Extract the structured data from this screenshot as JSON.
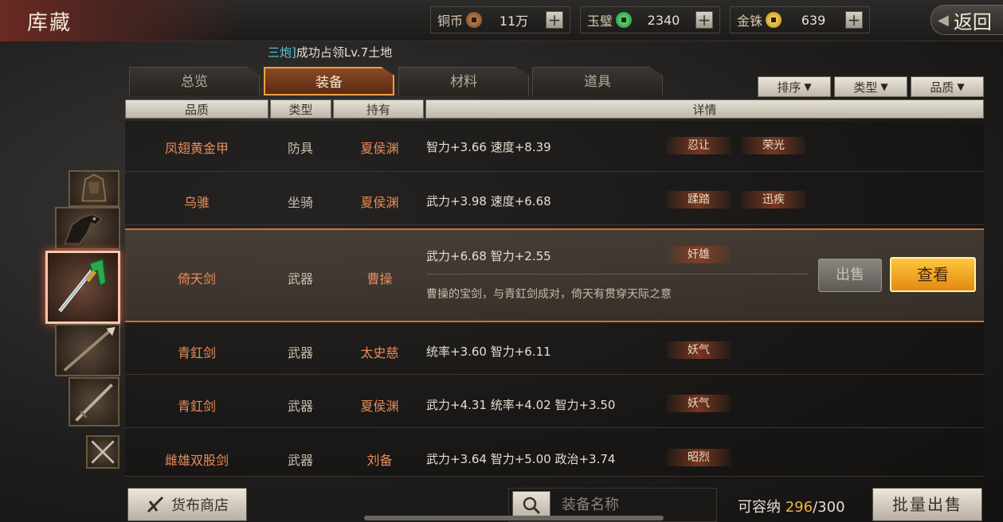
{
  "header": {
    "title": "库藏",
    "back_label": "返回",
    "currencies": [
      {
        "label": "铜币",
        "value": "11万",
        "icon": "copper-coin-icon",
        "color": "#a86a3a"
      },
      {
        "label": "玉璧",
        "value": "2340",
        "icon": "jade-disc-icon",
        "color": "#3cc060"
      },
      {
        "label": "金铢",
        "value": "639",
        "icon": "gold-coin-icon",
        "color": "#e8b820"
      }
    ],
    "plus": "+"
  },
  "notice": {
    "name": "三炮]",
    "text": "成功占领Lv.7土地"
  },
  "tabs": [
    {
      "label": "总览",
      "active": false
    },
    {
      "label": "装备",
      "active": true
    },
    {
      "label": "材料",
      "active": false
    },
    {
      "label": "道具",
      "active": false
    }
  ],
  "filters": [
    {
      "label": "排序"
    },
    {
      "label": "类型"
    },
    {
      "label": "品质"
    }
  ],
  "columns": [
    "品质",
    "类型",
    "持有",
    "详情"
  ],
  "rows": [
    {
      "name": "凤翅黄金甲",
      "type": "防具",
      "owner": "夏侯渊",
      "stats": "智力+3.66  速度+8.39",
      "tags": [
        "忍让",
        "荣光"
      ]
    },
    {
      "name": "乌骓",
      "type": "坐骑",
      "owner": "夏侯渊",
      "stats": "武力+3.98  速度+6.68",
      "tags": [
        "蹂踏",
        "迅疾"
      ]
    },
    {
      "name": "倚天剑",
      "type": "武器",
      "owner": "曹操",
      "stats": "武力+6.68  智力+2.55",
      "tags": [
        "奸雄"
      ],
      "desc": "曹操的宝剑，与青釭剑成对，倚天有贯穿天际之意",
      "selected": true
    },
    {
      "name": "青釭剑",
      "type": "武器",
      "owner": "太史慈",
      "stats": "统率+3.60  智力+6.11",
      "tags": [
        "妖气"
      ]
    },
    {
      "name": "青釭剑",
      "type": "武器",
      "owner": "夏侯渊",
      "stats": "武力+4.31  统率+4.02  智力+3.50",
      "tags": [
        "妖气"
      ]
    },
    {
      "name": "雌雄双股剑",
      "type": "武器",
      "owner": "刘备",
      "stats": "武力+3.64  智力+5.00  政治+3.74",
      "tags": [
        "昭烈"
      ]
    }
  ],
  "actions": {
    "sell": "出售",
    "view": "查看"
  },
  "bottom": {
    "shop_label": "货布商店",
    "search_placeholder": "装备名称",
    "capacity_label": "可容纳",
    "capacity_used": "296",
    "capacity_total": "/300",
    "bulk_sell": "批量出售"
  },
  "accent_colors": {
    "quality": "#e88c5a",
    "active_tab": "#f0a040",
    "view_button": "#f5a623"
  }
}
